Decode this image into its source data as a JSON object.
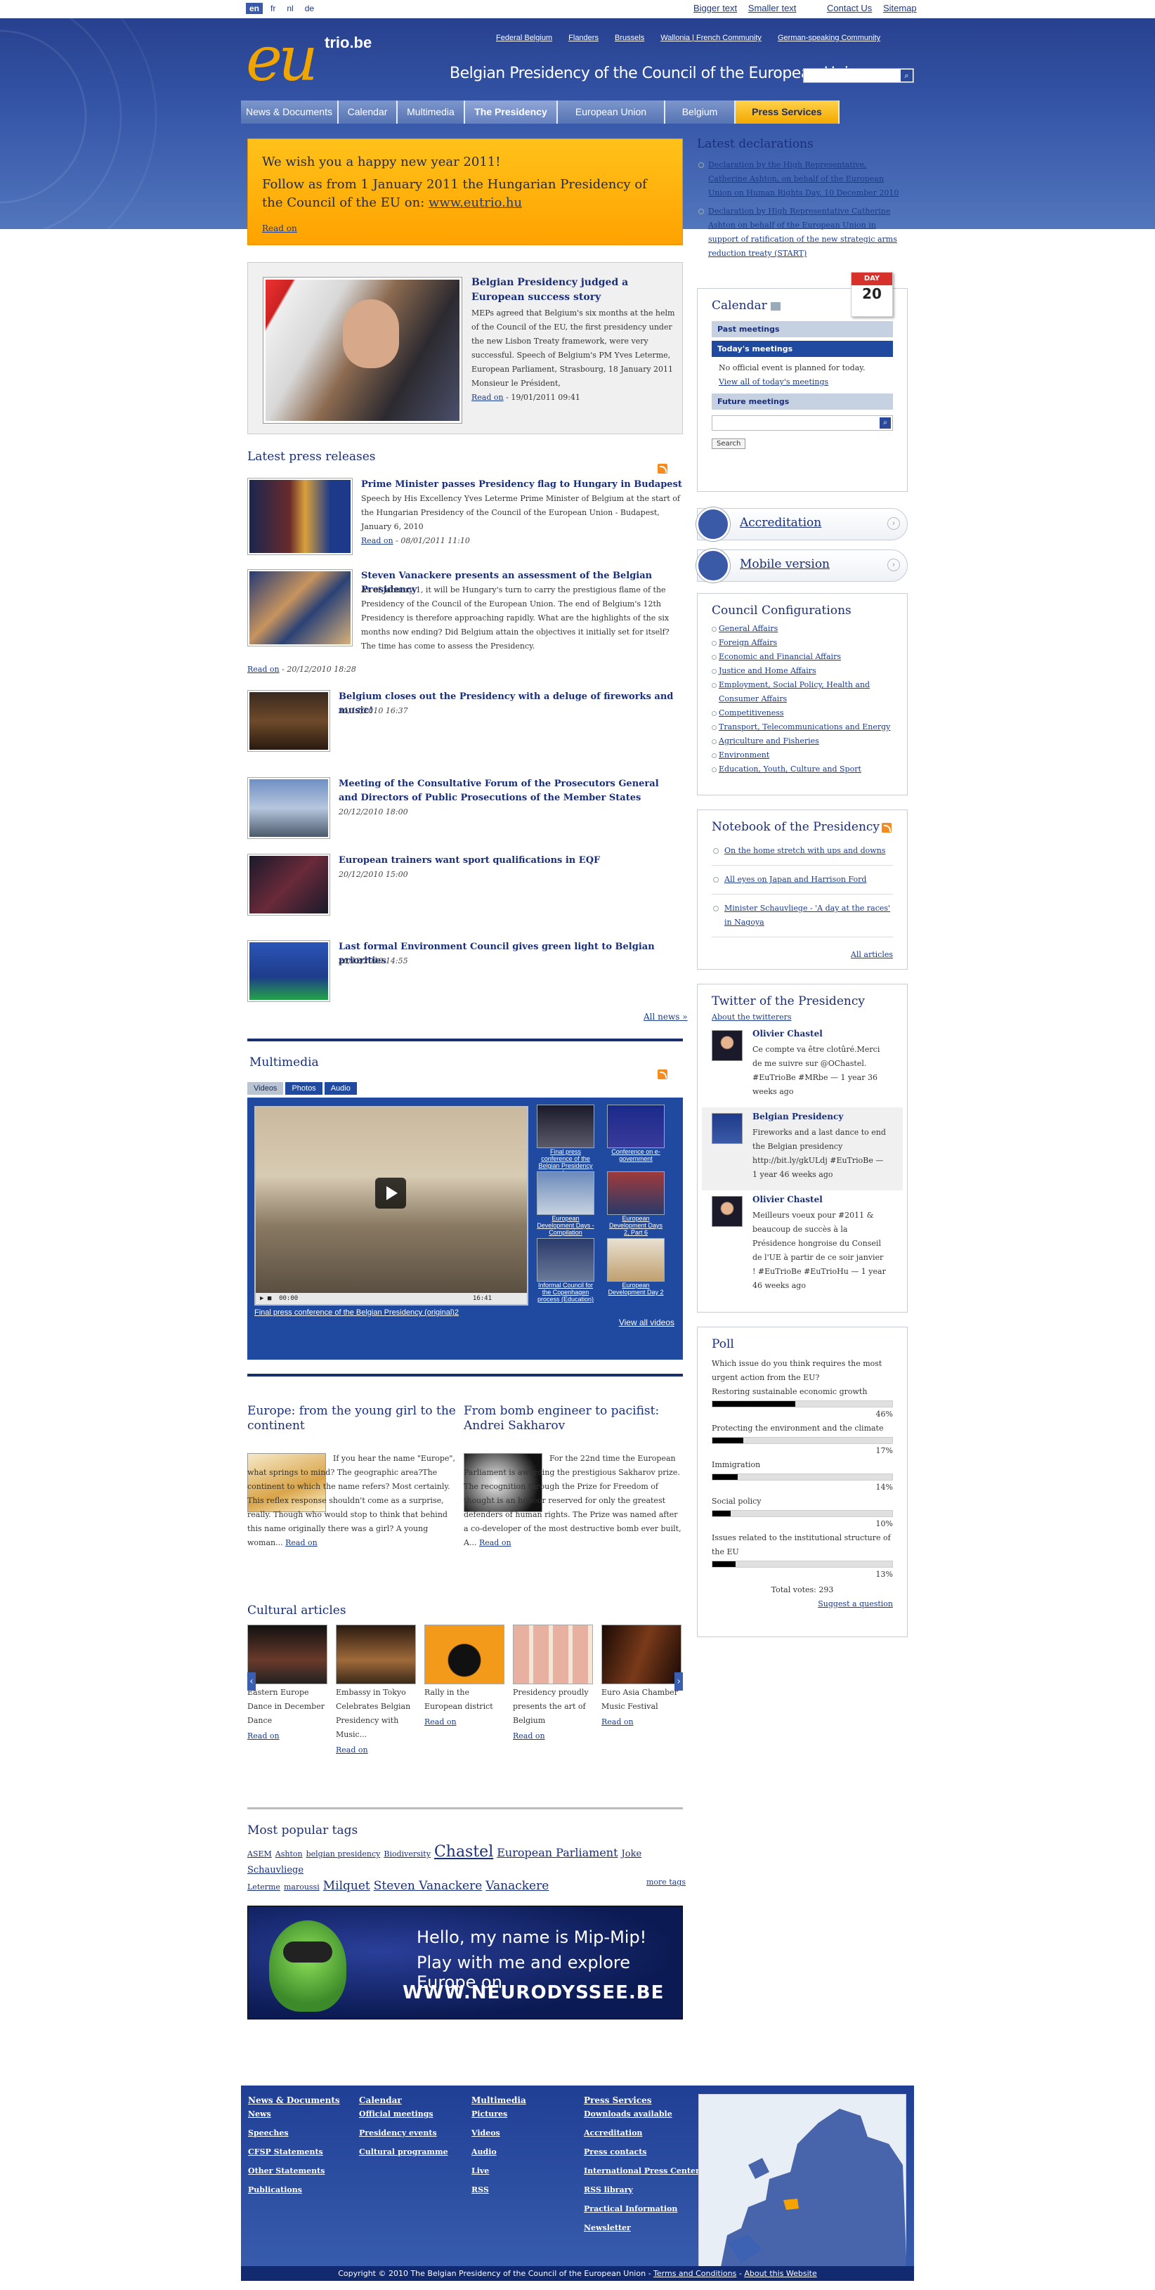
{
  "lang": {
    "en": "en",
    "fr": "fr",
    "nl": "nl",
    "de": "de"
  },
  "toplinks": {
    "bigger": "Bigger text",
    "smaller": "Smaller text",
    "contact": "Contact Us",
    "sitemap": "Sitemap"
  },
  "regions": [
    "Federal Belgium",
    "Flanders",
    "Brussels",
    "Wallonia | French Community",
    "German-speaking Community"
  ],
  "logo": {
    "eu": "eu",
    "trio": "trio.be"
  },
  "site_title": "Belgian Presidency of the Council of the European Union",
  "nav": [
    "News & Documents",
    "Calendar",
    "Multimedia",
    "The Presidency",
    "European Union",
    "Belgium",
    "Press Services"
  ],
  "promo": {
    "line1": "We wish you a happy new year 2011!",
    "line2": "Follow as from 1 January 2011 the Hungarian Presidency of the Council of the EU on:",
    "link": "www.eutrio.hu",
    "read_on": "Read on"
  },
  "featured": {
    "title": "Belgian Presidency judged a European success story",
    "text": "MEPs agreed that Belgium's six months at the helm of the Council of the EU, the first presidency under the new Lisbon Treaty framework, were very successful. Speech of Belgium's PM Yves Leterme, European Parliament, Strasbourg, 18 January 2011 Monsieur le Président,",
    "read_on": "Read on",
    "date": " - 19/01/2011 09:41"
  },
  "press": {
    "title": "Latest press releases",
    "items": [
      {
        "title": "Prime Minister passes Presidency flag to Hungary in Budapest",
        "text": "Speech by His Excellency Yves Leterme Prime Minister of Belgium at the start of the Hungarian Presidency of the Council of the European Union - Budapest, January 6, 2010",
        "read_on": "Read on",
        "date": " - 08/01/2011 11:10"
      },
      {
        "title": "Steven Vanackere presents an assessment of the Belgian Presidency",
        "text": "As of January 1, it will be Hungary's turn to carry the prestigious flame of the Presidency of the Council of the European Union. The end of Belgium's 12th Presidency is therefore approaching rapidly. What are the highlights of the six months now ending? Did Belgium attain the objectives it initially set for itself? The time has come to assess the Presidency.",
        "read_on": "Read on",
        "date": " - 20/12/2010 18:28"
      },
      {
        "title": "Belgium closes out the Presidency with a deluge of fireworks and music!",
        "date": "31/12/2010 16:37"
      },
      {
        "title": "Meeting of the Consultative Forum of the Prosecutors General and Directors of Public Prosecutions of the Member States",
        "date": "20/12/2010 18:00"
      },
      {
        "title": "European trainers want sport qualifications in EQF",
        "date": "20/12/2010 15:00"
      },
      {
        "title": "Last formal Environment Council gives green light to Belgian priorities",
        "date": "20/12/2010 14:55"
      }
    ],
    "all": "All news »"
  },
  "multimedia": {
    "title": "Multimedia",
    "tabs": [
      "Videos",
      "Photos",
      "Audio"
    ],
    "time": "00:00",
    "duration": "16:41",
    "thumbs": [
      "Final press conference of the Belgian Presidency (...",
      "Conference on e-government",
      "European Development Days - Compilation",
      "European Development Days 2, Part 6",
      "Informal Council for the Copenhagen process (Education)",
      "European Development Day 2"
    ],
    "caption": "Final press conference of the Belgian Presidency (original)2",
    "all": "View all videos"
  },
  "articles": [
    {
      "title": "Europe: from the young girl to the continent",
      "text": "If you hear the name \"Europe\", what springs to mind? The geographic area?The continent to which the name refers? Most certainly. This reflex response shouldn't come as a surprise, really. Though who would stop to think that behind this name originally there was a girl? A young woman...",
      "read_on": "Read on"
    },
    {
      "title": "From bomb engineer to pacifist: Andrei Sakharov",
      "text": "For the 22nd time the European Parliament is awarding the prestigious Sakharov prize. The recognition through the Prize for Freedom of thought is an honour reserved for only the greatest defenders of human rights. The Prize was named after a co-developer of the most destructive bomb ever built, A...",
      "read_on": "Read on"
    }
  ],
  "cultural": {
    "title": "Cultural articles",
    "items": [
      {
        "cap": "Eastern Europe Dance in December Dance",
        "read": "Read on"
      },
      {
        "cap": "Embassy in Tokyo Celebrates Belgian Presidency with Music...",
        "read": "Read on"
      },
      {
        "cap": "Rally in the European district",
        "read": "Read on"
      },
      {
        "cap": "Presidency proudly presents the art of Belgium",
        "read": "Read on"
      },
      {
        "cap": "Euro Asia Chamber Music Festival",
        "read": "Read on"
      }
    ]
  },
  "tags": {
    "title": "Most popular tags",
    "items": [
      "ASEM",
      "Ashton",
      "belgian presidency",
      "Biodiversity",
      "Chastel",
      "European Parliament",
      "Joke Schauvliege",
      "Leterme",
      "maroussi",
      "Milquet",
      "Steven Vanackere",
      "Vanackere"
    ],
    "more": "more tags"
  },
  "banner": {
    "l1": "Hello, my name is Mip-Mip!",
    "l2": "Play with me and explore Europe on",
    "l3": "WWW.NEURODYSSEE.BE"
  },
  "declarations": {
    "title": "Latest declarations",
    "items": [
      "Declaration by the High Representative, Catherine Ashton, on behalf of the European Union on Human Rights Day, 10 December 2010",
      "Declaration by High Representative Catherine Ashton on behalf of the European Union in support of ratification of the new strategic arms reduction treaty (START)"
    ]
  },
  "calendar": {
    "title": "Calendar",
    "day": "DAY",
    "num": "20",
    "past": "Past meetings",
    "today": "Today's meetings",
    "none": "No official event is planned for today.",
    "view_all": "View all of today's meetings",
    "future": "Future meetings",
    "search": "Search"
  },
  "widgets": {
    "accreditation": "Accreditation",
    "mobile": "Mobile version"
  },
  "council": {
    "title": "Council Configurations",
    "items": [
      "General Affairs",
      "Foreign Affairs",
      "Economic and Financial Affairs",
      "Justice and Home Affairs",
      "Employment, Social Policy, Health and Consumer Affairs",
      "Competitiveness",
      "Transport, Telecommunications and Energy",
      "Agriculture and Fisheries",
      "Environment",
      "Education, Youth, Culture and Sport"
    ]
  },
  "notebook": {
    "title": "Notebook of the Presidency",
    "items": [
      "On the home stretch with ups and downs",
      "All eyes on Japan and Harrison Ford",
      "Minister Schauvliege - 'A day at the races' in Nagoya"
    ],
    "all": "All articles"
  },
  "twitter": {
    "title": "Twitter of the Presidency",
    "about": "About the twitterers",
    "items": [
      {
        "name": "Olivier Chastel",
        "msg": "Ce compte va être clotûré.Merci de me suivre sur @OChastel. #EuTrioBe #MRbe — 1 year 36 weeks ago"
      },
      {
        "name": "Belgian Presidency",
        "msg": "Fireworks and a last dance to end the Belgian presidency http://bit.ly/gkULdj #EuTrioBe — 1 year 46 weeks ago"
      },
      {
        "name": "Olivier Chastel",
        "msg": "Meilleurs voeux pour #2011 & beaucoup de succès à la Présidence hongroise du Conseil de l'UE à partir de ce soir janvier ! #EuTrioBe #EuTrioHu — 1 year 46 weeks ago"
      }
    ]
  },
  "poll": {
    "title": "Poll",
    "question": "Which issue do you think requires the most urgent action from the EU?",
    "options": [
      {
        "label": "Restoring sustainable economic growth",
        "pct": "46%",
        "value": 0.46
      },
      {
        "label": "Protecting the environment and the climate",
        "pct": "17%",
        "value": 0.17
      },
      {
        "label": "Immigration",
        "pct": "14%",
        "value": 0.14
      },
      {
        "label": "Social policy",
        "pct": "10%",
        "value": 0.1
      },
      {
        "label": "Issues related to the institutional structure of the EU",
        "pct": "13%",
        "value": 0.13
      }
    ],
    "total": "Total votes: 293",
    "suggest": "Suggest a question"
  },
  "footer": {
    "cols": [
      {
        "head": "News & Documents",
        "links": [
          "News",
          "Speeches",
          "CFSP Statements",
          "Other Statements",
          "Publications"
        ]
      },
      {
        "head": "Calendar",
        "links": [
          "Official meetings",
          "Presidency events",
          "Cultural programme"
        ]
      },
      {
        "head": "Multimedia",
        "links": [
          "Pictures",
          "Videos",
          "Audio",
          "Live",
          "RSS"
        ]
      },
      {
        "head": "Press Services",
        "links": [
          "Downloads available",
          "Accreditation",
          "Press contacts",
          "International Press Center",
          "RSS library",
          "Practical Information",
          "Newsletter"
        ]
      }
    ],
    "copyright": "Copyright © 2010 The Belgian Presidency of the Council of the European Union - ",
    "terms": "Terms and Conditions",
    "sep": " - ",
    "about": "About this Website"
  },
  "colors": {
    "primary": "#1f4aa0",
    "accent": "#ffa200",
    "header": "#27418f"
  }
}
